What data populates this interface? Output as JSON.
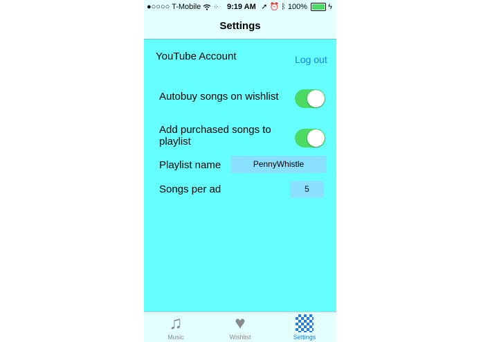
{
  "status_bar": {
    "signal": "●○○○○",
    "carrier": "T-Mobile",
    "time": "9:19 AM",
    "battery": "100%"
  },
  "nav": {
    "title": "Settings"
  },
  "account": {
    "label": "YouTube Account",
    "logout": "Log out"
  },
  "settings": {
    "autobuy": {
      "label": "Autobuy songs on wishlist",
      "on": true
    },
    "add_to_playlist": {
      "label_line1": "Add purchased songs to",
      "label_line2": "playlist",
      "on": true
    },
    "playlist_name": {
      "label": "Playlist name",
      "value": "PennyWhistle"
    },
    "songs_per_ad": {
      "label": "Songs per ad",
      "value": "5"
    }
  },
  "tabs": [
    {
      "label": "Music",
      "icon": "music-note-icon"
    },
    {
      "label": "Wishlist",
      "icon": "heart-icon"
    },
    {
      "label": "Settings",
      "icon": "checkerboard-icon",
      "active": true
    }
  ],
  "colors": {
    "background": "#66ffff",
    "bars": "#e3ffff",
    "toggle_on": "#4cd964",
    "accent": "#1a7df0",
    "field": "#8ae0ff"
  }
}
